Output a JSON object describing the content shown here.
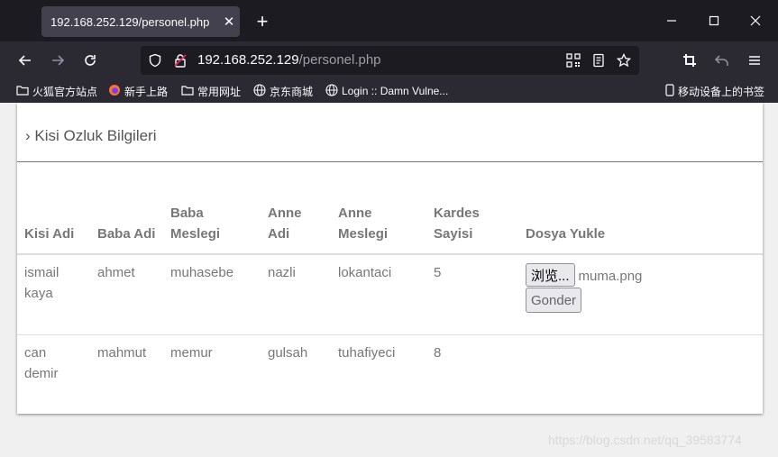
{
  "browser": {
    "tab_title": "192.168.252.129/personel.php",
    "tab_close": "✕",
    "new_tab": "+",
    "url_host": "192.168.252.129",
    "url_path": "/personel.php"
  },
  "bookmarks": [
    {
      "label": "火狐官方站点"
    },
    {
      "label": "新手上路"
    },
    {
      "label": "常用网址"
    },
    {
      "label": "京东商城"
    },
    {
      "label": "Login :: Damn Vulne..."
    }
  ],
  "mobile_bookmarks": "移动设备上的书签",
  "page": {
    "title": "Kisi Ozluk Bilgileri",
    "columns": [
      "Kisi Adi",
      "Baba Adi",
      "Baba Meslegi",
      "Anne Adi",
      "Anne Meslegi",
      "Kardes Sayisi",
      "Dosya Yukle"
    ],
    "rows": [
      {
        "kisi_adi": "ismail kaya",
        "baba_adi": "ahmet",
        "baba_meslegi": "muhasebe",
        "anne_adi": "nazli",
        "anne_meslegi": "lokantaci",
        "kardes_sayisi": "5"
      },
      {
        "kisi_adi": "can demir",
        "baba_adi": "mahmut",
        "baba_meslegi": "memur",
        "anne_adi": "gulsah",
        "anne_meslegi": "tuhafiyeci",
        "kardes_sayisi": "8"
      }
    ],
    "upload": {
      "browse_label": "浏览...",
      "file_name": "muma.png",
      "submit_label": "Gonder"
    }
  },
  "watermark": "https://blog.csdn.net/qq_39583774"
}
